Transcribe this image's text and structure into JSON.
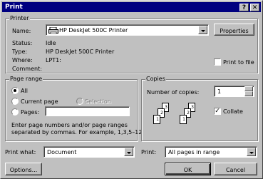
{
  "window": {
    "title": "Print",
    "help_btn": "?",
    "close_btn": "✕"
  },
  "printer": {
    "group_label": "Printer",
    "name_label": "Name:",
    "name_value": "HP DeskJet 500C Printer",
    "properties": "Properties",
    "status_label": "Status:",
    "status_value": "Idle",
    "type_label": "Type:",
    "type_value": "HP DeskJet 500C Printer",
    "where_label": "Where:",
    "where_value": "LPT1:",
    "comment_label": "Comment:",
    "comment_value": "",
    "print_to_file": "Print to file"
  },
  "page_range": {
    "group_label": "Page range",
    "all": "All",
    "current_page": "Current page",
    "selection": "Selection",
    "pages": "Pages:",
    "pages_value": "",
    "hint_line1": "Enter page numbers and/or page ranges",
    "hint_line2": "separated by commas.  For example, 1,3,5–12"
  },
  "copies": {
    "group_label": "Copies",
    "number_label": "Number of copies:",
    "number_value": "1",
    "collate": "Collate",
    "collate_checked": true,
    "page_numbers": [
      "3",
      "2",
      "1",
      "3",
      "2",
      "1"
    ]
  },
  "bottom": {
    "print_what_label": "Print what:",
    "print_what_value": "Document",
    "print_label": "Print:",
    "print_value": "All pages in range",
    "options": "Options...",
    "ok": "OK",
    "cancel": "Cancel"
  }
}
